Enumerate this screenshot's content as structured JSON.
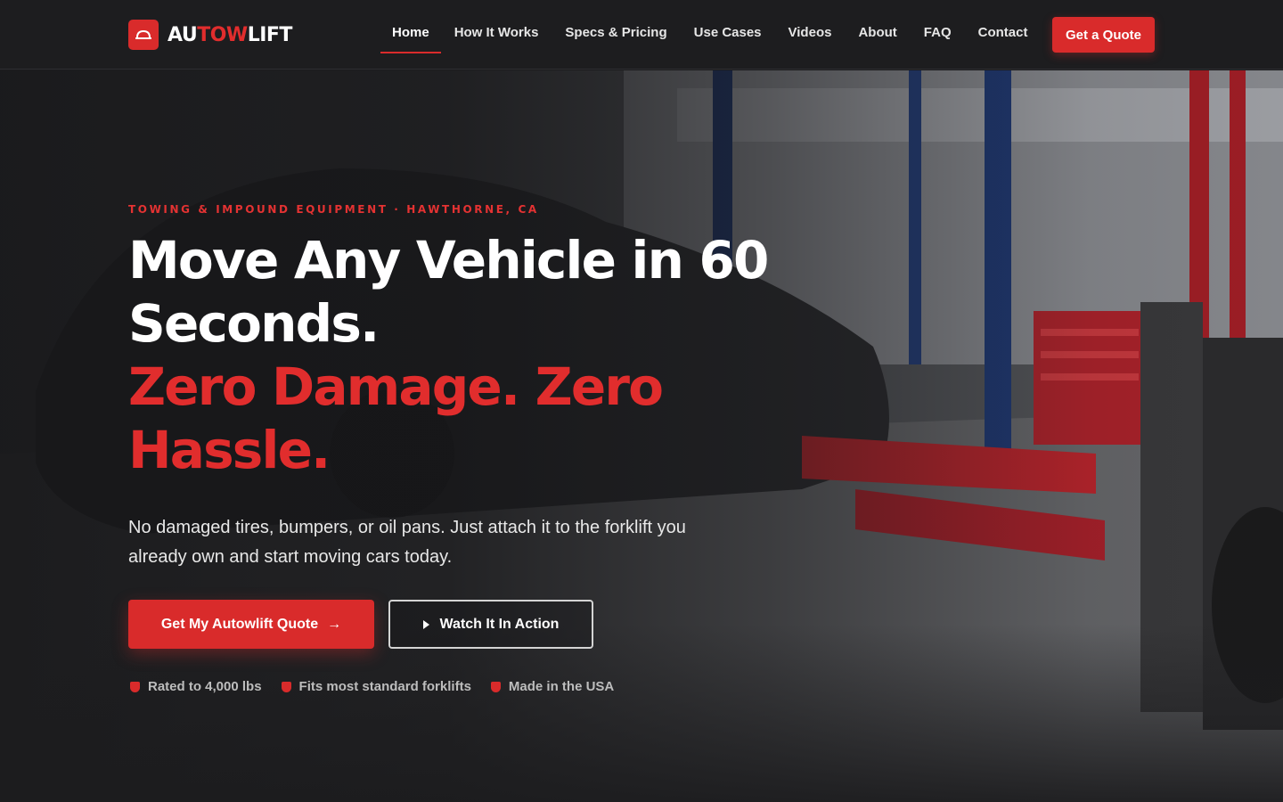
{
  "brand": {
    "name_part1": "AU",
    "name_part2": "TOW",
    "name_part3": "LIFT",
    "logo_icon": "tow-truck-icon",
    "accent_color": "#d92b2b"
  },
  "nav": {
    "items": [
      {
        "label": "Home",
        "active": true
      },
      {
        "label": "How It Works",
        "active": false
      },
      {
        "label": "Specs & Pricing",
        "active": false
      },
      {
        "label": "Use Cases",
        "active": false
      },
      {
        "label": "Videos",
        "active": false
      },
      {
        "label": "About",
        "active": false
      },
      {
        "label": "FAQ",
        "active": false
      },
      {
        "label": "Contact",
        "active": false
      }
    ],
    "cta_label": "Get a Quote"
  },
  "hero": {
    "eyebrow": "TOWING & IMPOUND EQUIPMENT · HAWTHORNE, CA",
    "headline_line1": "Move Any Vehicle in 60",
    "headline_line2": "Seconds.",
    "headline_line3": "Zero Damage. Zero",
    "headline_line4": "Hassle.",
    "subtext": "No damaged tires, bumpers, or oil pans. Just attach it to the forklift you already own and start moving cars today.",
    "primary_cta": "Get My Autowlift Quote",
    "primary_cta_icon": "arrow-right-icon",
    "secondary_cta": "Watch It In Action",
    "secondary_cta_icon": "play-icon",
    "badges": [
      {
        "label": "Rated to 4,000 lbs",
        "icon": "shield-icon"
      },
      {
        "label": "Fits most standard forklifts",
        "icon": "shield-icon"
      },
      {
        "label": "Made in the USA",
        "icon": "shield-icon"
      }
    ]
  }
}
